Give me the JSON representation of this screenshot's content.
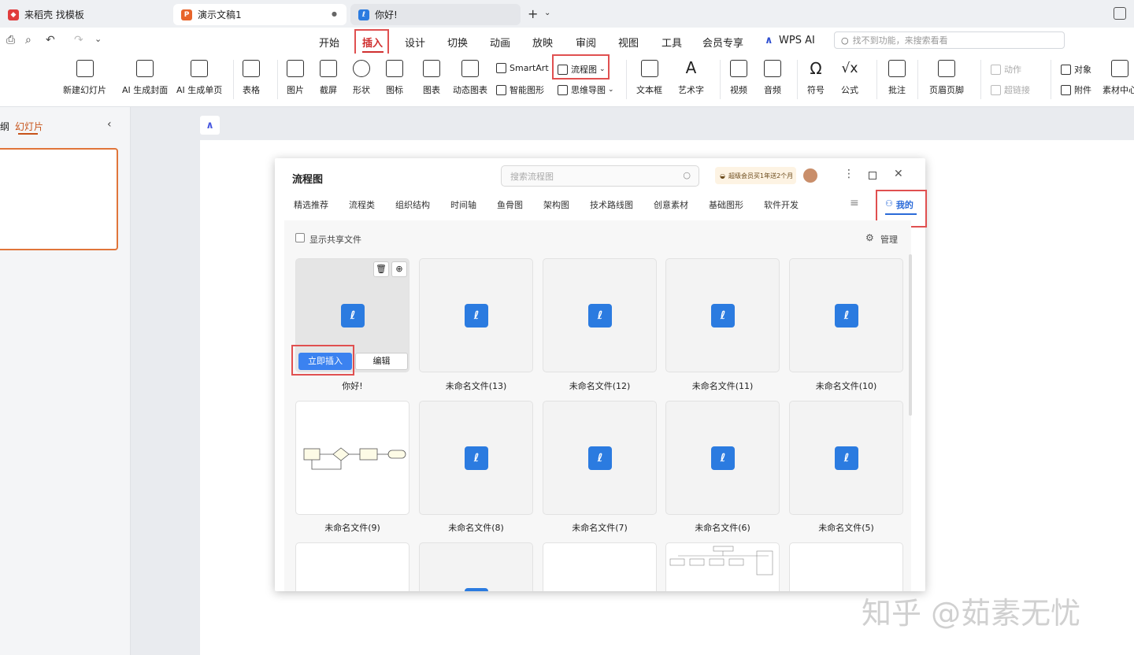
{
  "tabs": [
    {
      "label": "来稻壳 找模板",
      "icon": "docer-icon"
    },
    {
      "label": "演示文稿1",
      "icon": "ppt-icon"
    },
    {
      "label": "你好!",
      "icon": "flowchart-icon"
    }
  ],
  "menu": {
    "items": [
      "开始",
      "插入",
      "设计",
      "切换",
      "动画",
      "放映",
      "审阅",
      "视图",
      "工具",
      "会员专享"
    ],
    "wps_ai": "WPS AI",
    "search_placeholder": "找不到功能，来搜索看看"
  },
  "ribbon": {
    "buttons": [
      "新建幻灯片",
      "AI 生成封面",
      "AI 生成单页",
      "表格",
      "图片",
      "截屏",
      "形状",
      "图标",
      "图表",
      "动态图表",
      "文本框",
      "艺术字",
      "视频",
      "音频",
      "符号",
      "公式",
      "批注",
      "页眉页脚"
    ],
    "smartart": "SmartArt",
    "smart_shape": "智能图形",
    "flowchart": "流程图",
    "mindmap": "思维导图",
    "action": "动作",
    "hyperlink": "超链接",
    "object": "对象",
    "attachment": "附件",
    "material": "素材中心"
  },
  "leftpanel": {
    "outline_tab": "纲",
    "slides_tab": "幻灯片"
  },
  "dialog": {
    "title": "流程图",
    "search_placeholder": "搜索流程图",
    "vip_badge": "超级会员买1年送2个月",
    "categories": [
      "精选推荐",
      "流程类",
      "组织结构",
      "时间轴",
      "鱼骨图",
      "架构图",
      "技术路线图",
      "创意素材",
      "基础图形",
      "软件开发"
    ],
    "mine_tab": "我的",
    "show_shared": "显示共享文件",
    "manage": "管理",
    "insert_now": "立即插入",
    "edit": "编辑",
    "files": [
      "你好!",
      "未命名文件(13)",
      "未命名文件(12)",
      "未命名文件(11)",
      "未命名文件(10)",
      "未命名文件(9)",
      "未命名文件(8)",
      "未命名文件(7)",
      "未命名文件(6)",
      "未命名文件(5)"
    ]
  },
  "watermark": "知乎 @茹素无忧"
}
